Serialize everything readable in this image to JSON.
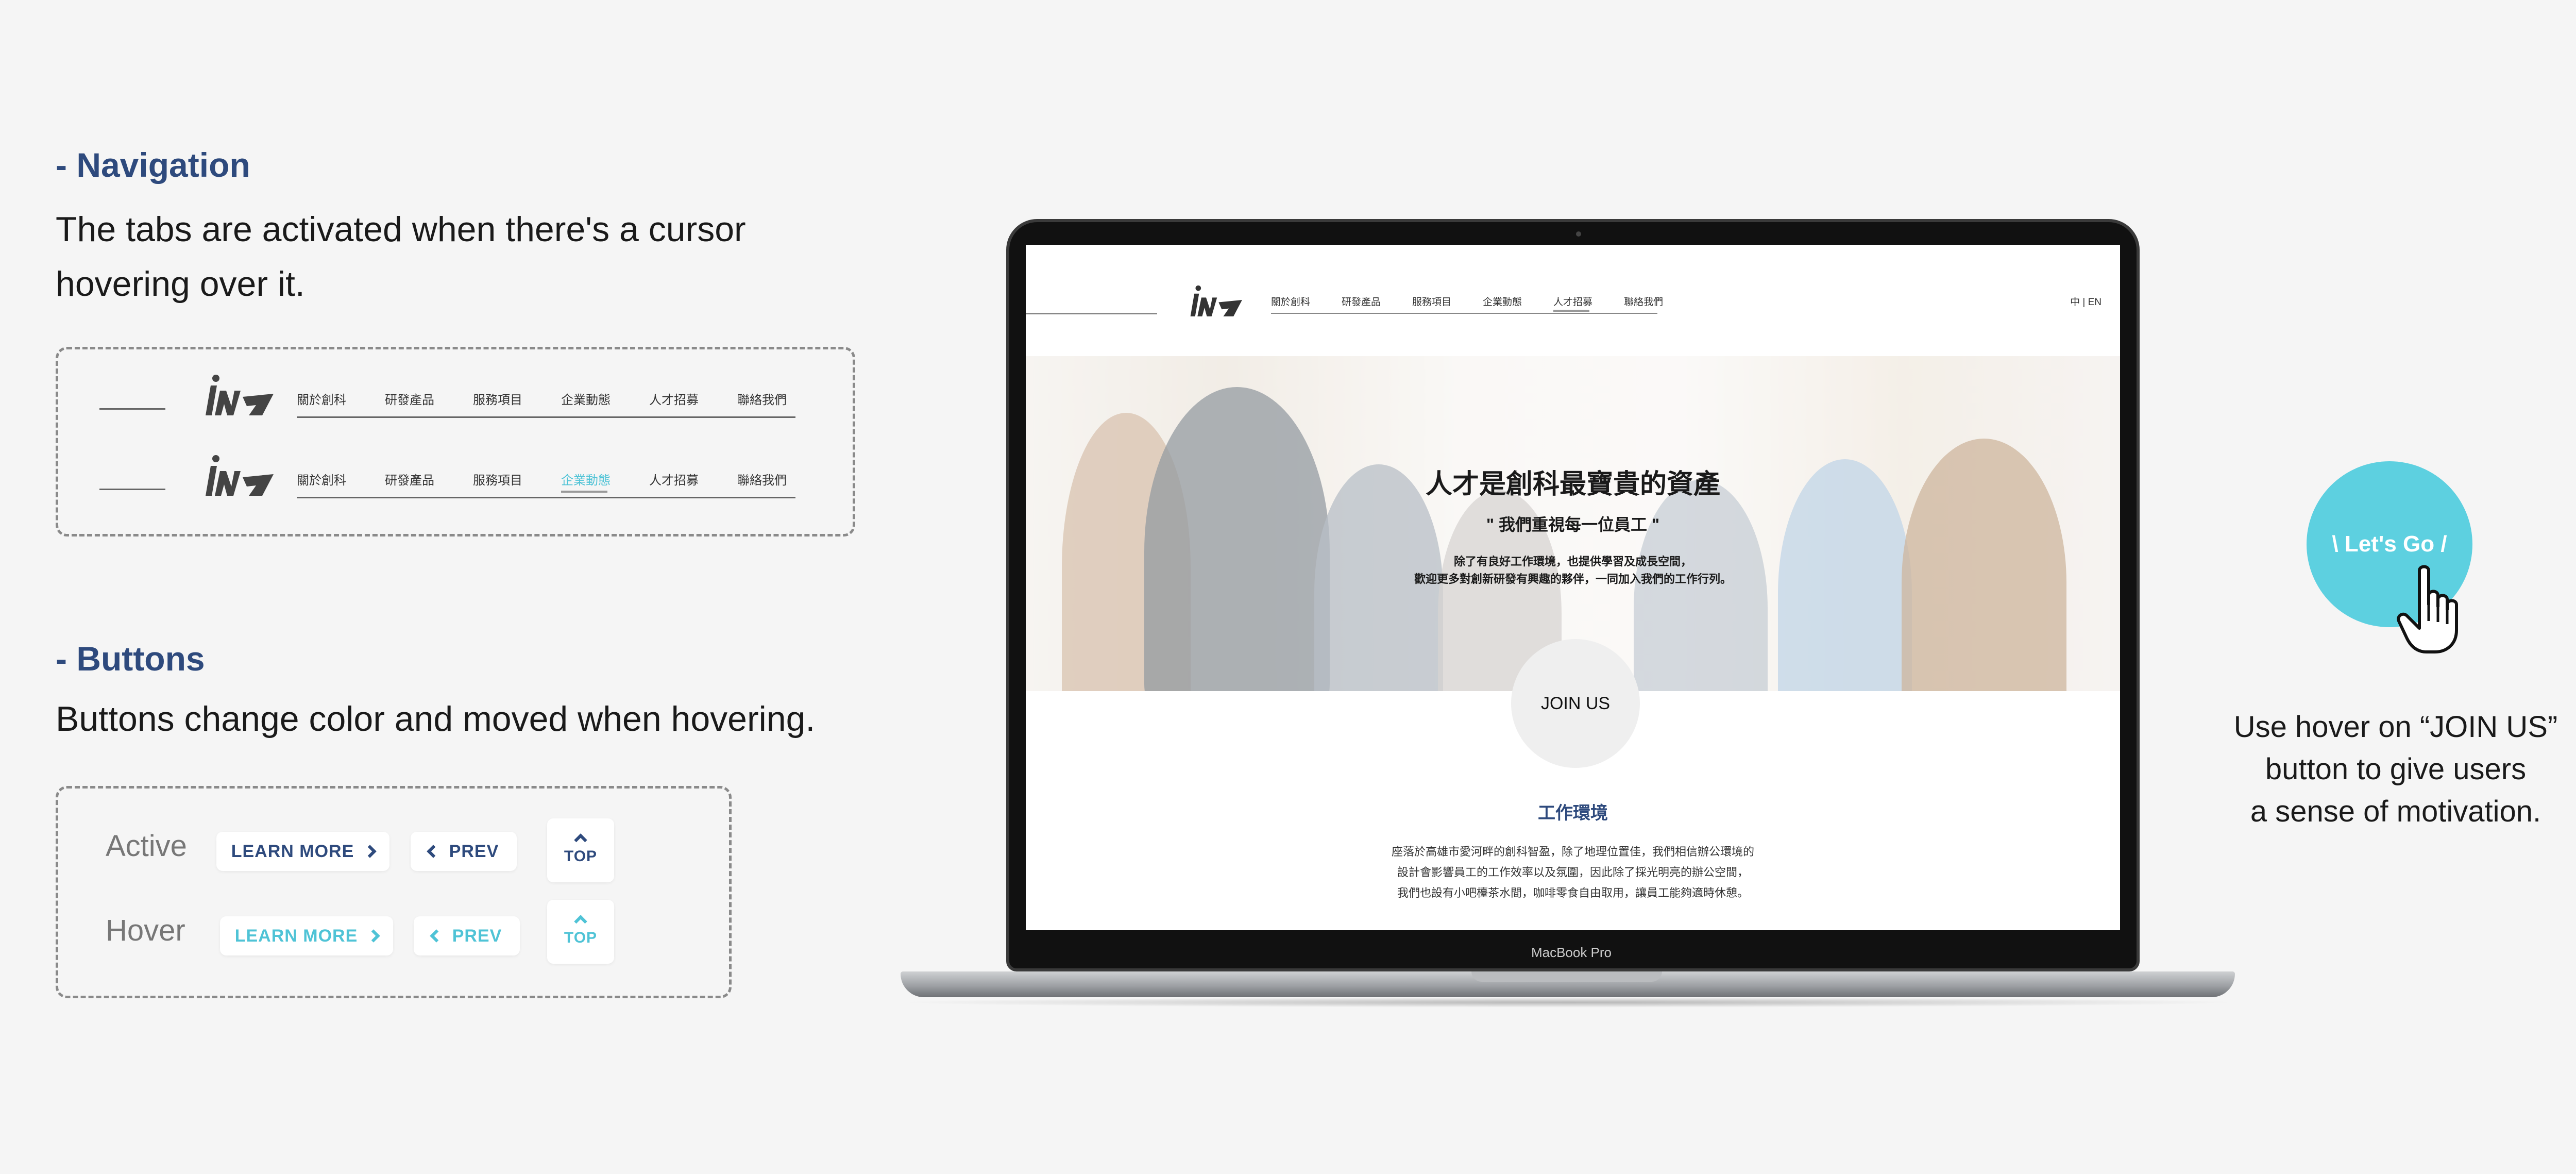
{
  "navigation_section": {
    "title": "- Navigation",
    "description_line1": "The tabs are activated when there's a cursor",
    "description_line2": "hovering over it.",
    "tabs": [
      "關於創科",
      "研發產品",
      "服務項目",
      "企業動態",
      "人才招募",
      "聯絡我們"
    ],
    "hover_tab_index": 3
  },
  "buttons_section": {
    "title": "- Buttons",
    "description": "Buttons change color and moved when hovering.",
    "active_label": "Active",
    "hover_label": "Hover",
    "learn_more": "LEARN MORE",
    "prev": "PREV",
    "top": "TOP"
  },
  "site": {
    "tabs": [
      "關於創科",
      "研發產品",
      "服務項目",
      "企業動態",
      "人才招募",
      "聯絡我們"
    ],
    "current_tab_index": 4,
    "lang": "中 | EN",
    "hero_title": "人才是創科最寶貴的資產",
    "hero_subtitle": "\" 我們重視每一位員工 \"",
    "hero_body_line1": "除了有良好工作環境，也提供學習及成長空間，",
    "hero_body_line2": "歡迎更多對創新研發有興趣的夥伴，一同加入我們的工作行列。",
    "join_button": "JOIN US",
    "work_title": "工作環境",
    "work_body_line1": "座落於高雄市愛河畔的創科智盈，除了地理位置佳，我們相信辦公環境的",
    "work_body_line2": "設計會影響員工的工作效率以及氛圍，因此除了採光明亮的辦公空間，",
    "work_body_line3": "我們也設有小吧檯茶水間，咖啡零食自由取用，讓員工能夠適時休憩。"
  },
  "device_label": "MacBook Pro",
  "cta": {
    "label": "\\ Let's Go /",
    "note_line1": "Use hover on “JOIN US”",
    "note_line2": "button to give users",
    "note_line3": "a sense of motivation."
  },
  "colors": {
    "heading_blue": "#2e4a7d",
    "accent_cyan": "#5dd0e0",
    "hover_cyan": "#4fc3d6"
  }
}
